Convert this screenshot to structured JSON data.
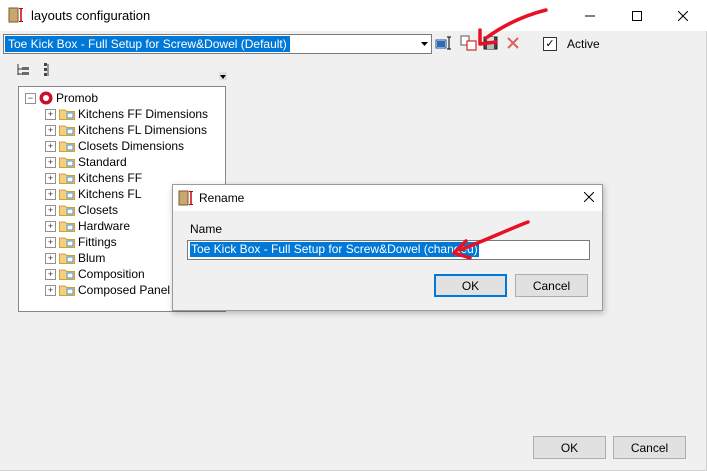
{
  "window": {
    "title": "layouts configuration",
    "minimize_icon": "minimize-icon",
    "maximize_icon": "maximize-icon",
    "close_icon": "close-icon"
  },
  "toolbar": {
    "selected_layout": "Toe Kick Box - Full Setup for Screw&Dowel (Default)",
    "active_label": "Active",
    "active_checked": true,
    "icons": [
      "edit-icon",
      "rename-icon",
      "save-icon",
      "delete-icon"
    ]
  },
  "tree": {
    "root": "Promob",
    "items": [
      "Kitchens FF Dimensions",
      "Kitchens FL Dimensions",
      "Closets Dimensions",
      "Standard",
      "Kitchens FF",
      "Kitchens FL",
      "Closets",
      "Hardware",
      "Fittings",
      "Blum",
      "Composition",
      "Composed Panel"
    ]
  },
  "rename_dialog": {
    "title": "Rename",
    "name_label": "Name",
    "name_value": "Toe Kick Box - Full Setup for Screw&Dowel (changed)",
    "ok_label": "OK",
    "cancel_label": "Cancel"
  },
  "footer": {
    "ok_label": "OK",
    "cancel_label": "Cancel"
  },
  "colors": {
    "selection": "#0078d7",
    "annotation_arrow": "#e81123"
  }
}
